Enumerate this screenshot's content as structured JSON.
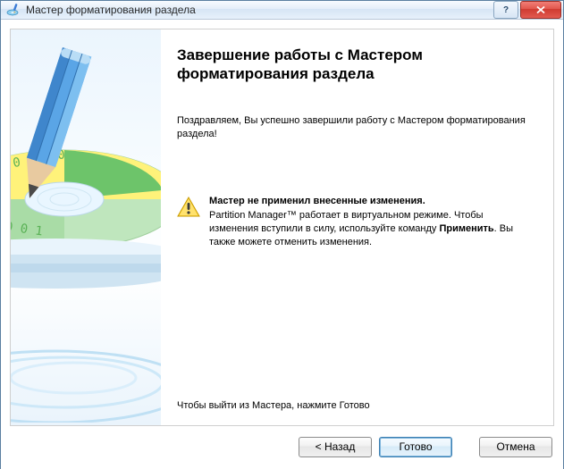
{
  "window": {
    "title": "Мастер форматирования раздела"
  },
  "heading": "Завершение работы с Мастером форматирования раздела",
  "congrats": "Поздравляем, Вы успешно завершили работу с Мастером форматирования раздела!",
  "warning": {
    "title": "Мастер не применил внесенные изменения.",
    "body_before_cmd": "Partition Manager™ работает в виртуальном режиме. Чтобы изменения вступили в силу, используйте команду ",
    "cmd": "Применить",
    "body_after_cmd": ". Вы также можете отменить изменения."
  },
  "exit_hint": "Чтобы выйти из Мастера, нажмите Готово",
  "buttons": {
    "back": "< Назад",
    "finish": "Готово",
    "cancel": "Отмена"
  }
}
